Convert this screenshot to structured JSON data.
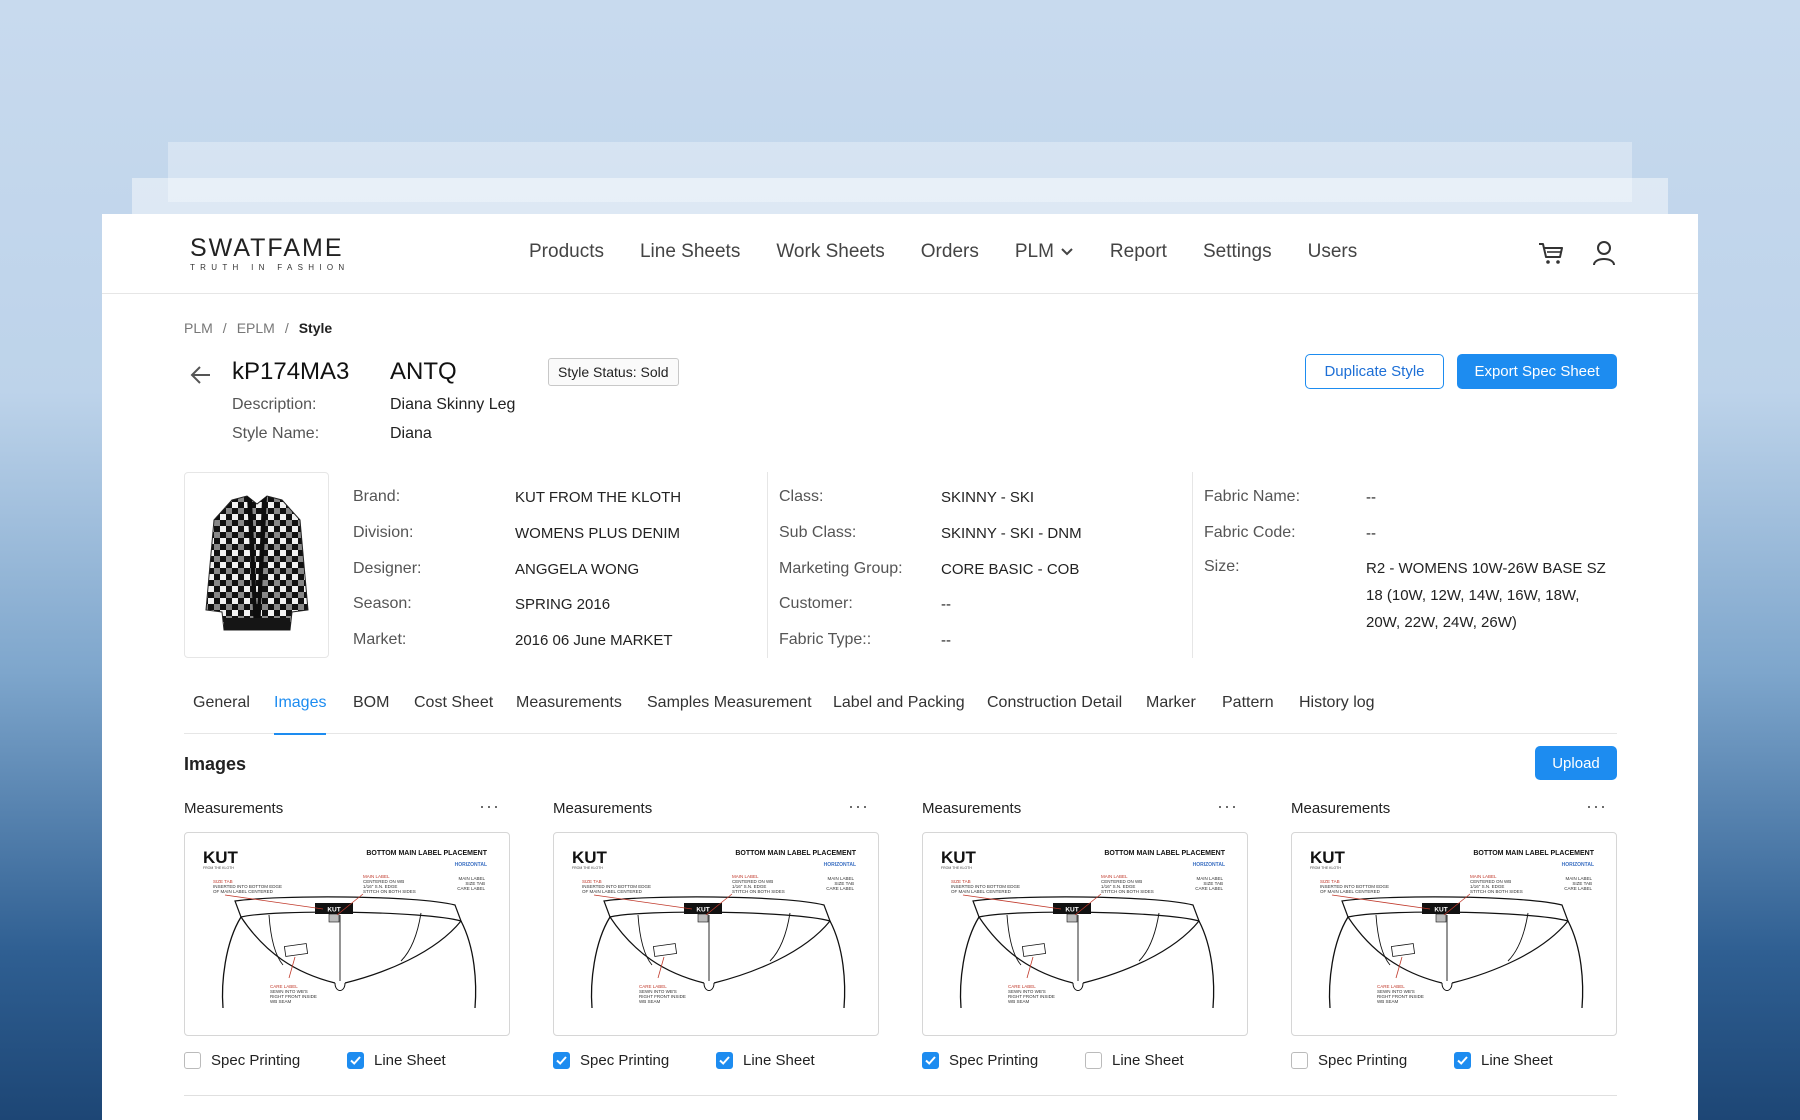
{
  "brand": {
    "logo_main": "SWATFAME",
    "logo_sub": "TRUTH IN FASHION"
  },
  "nav": {
    "items": [
      "Products",
      "Line Sheets",
      "Work Sheets",
      "Orders",
      "PLM",
      "Report",
      "Settings",
      "Users"
    ]
  },
  "breadcrumb": {
    "items": [
      "PLM",
      "EPLM",
      "Style"
    ],
    "separator": "/"
  },
  "style": {
    "code": "kP174MA3",
    "tag": "ANTQ",
    "status": "Style Status: Sold",
    "description_label": "Description:",
    "description": "Diana Skinny Leg",
    "style_name_label": "Style Name:",
    "style_name": "Diana"
  },
  "actions": {
    "duplicate": "Duplicate Style",
    "export": "Export Spec Sheet"
  },
  "details": {
    "col1": [
      {
        "label": "Brand:",
        "value": "KUT FROM THE KLOTH"
      },
      {
        "label": "Division:",
        "value": "WOMENS PLUS DENIM"
      },
      {
        "label": "Designer:",
        "value": "ANGGELA WONG"
      },
      {
        "label": "Season:",
        "value": "SPRING 2016"
      },
      {
        "label": "Market:",
        "value": "2016 06 June MARKET"
      }
    ],
    "col2": [
      {
        "label": "Class:",
        "value": "SKINNY - SKI"
      },
      {
        "label": "Sub Class:",
        "value": "SKINNY - SKI - DNM"
      },
      {
        "label": "Marketing Group:",
        "value": "CORE BASIC - COB"
      },
      {
        "label": "Customer:",
        "value": "--"
      },
      {
        "label": "Fabric Type::",
        "value": "--"
      }
    ],
    "col3": [
      {
        "label": "Fabric Name:",
        "value": "--"
      },
      {
        "label": "Fabric Code:",
        "value": "--"
      },
      {
        "label": "Size:",
        "value": "R2 - WOMENS 10W-26W BASE SZ 18 (10W, 12W, 14W, 16W, 18W, 20W, 22W, 24W, 26W)"
      }
    ]
  },
  "tabs": {
    "items": [
      "General",
      "Images",
      "BOM",
      "Cost Sheet",
      "Measurements",
      "Samples Measurement",
      "Label and Packing",
      "Construction Detail",
      "Marker",
      "Pattern",
      "History log"
    ],
    "active": "Images"
  },
  "images_section": {
    "title": "Images",
    "upload": "Upload",
    "more_glyph": "···",
    "cards": [
      {
        "title": "Measurements",
        "spec_label": "Spec Printing",
        "spec_checked": false,
        "line_label": "Line Sheet",
        "line_checked": true
      },
      {
        "title": "Measurements",
        "spec_label": "Spec Printing",
        "spec_checked": true,
        "line_label": "Line Sheet",
        "line_checked": true
      },
      {
        "title": "Measurements",
        "spec_label": "Spec Printing",
        "spec_checked": true,
        "line_label": "Line Sheet",
        "line_checked": false
      },
      {
        "title": "Measurements",
        "spec_label": "Spec Printing",
        "spec_checked": false,
        "line_label": "Line Sheet",
        "line_checked": true
      }
    ],
    "drawing": {
      "brand": "KUT",
      "brand_sub": "FROM THE KLOTH",
      "heading": "BOTTOM MAIN LABEL PLACEMENT",
      "subheading": "HORIZONTAL",
      "size_tab": "SIZE TAB",
      "size_tab_note_1": "INSERTED INTO BOTTOM EDGE",
      "size_tab_note_2": "OF MAIN LABEL CENTERED",
      "main_label": "MAIN LABEL",
      "main_label_note_1": "CENTERED ON WB",
      "main_label_note_2": "1/16\" S.N. EDGE",
      "main_label_note_3": "STITCH ON BOTH SIDES",
      "legend_1": "MAIN LABEL",
      "legend_2": "SIZE TAB",
      "legend_3": "CARE LABEL",
      "care_label": "CARE LABEL",
      "care_note_1": "SEWN INTO WB'S",
      "care_note_2": "RIGHT FRONT INSIDE",
      "care_note_3": "WB SEAM",
      "tab_text": "KUT"
    }
  },
  "colors": {
    "accent": "#1d8cf0",
    "text": "#222222",
    "muted": "#555555",
    "border": "#e6e6e6"
  }
}
